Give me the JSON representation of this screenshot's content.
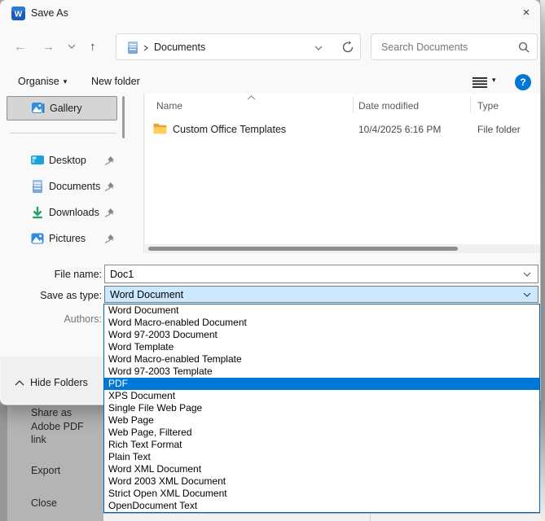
{
  "window": {
    "title": "Save As",
    "close_glyph": "×",
    "word_glyph": "W"
  },
  "nav": {
    "back_glyph": "←",
    "forward_glyph": "→",
    "up_glyph": "↑",
    "breadcrumb": "Documents",
    "search_placeholder": "Search Documents"
  },
  "toolbar": {
    "organise": "Organise",
    "caret_glyph": "▾",
    "new_folder": "New folder",
    "help_glyph": "?"
  },
  "sidebar": {
    "items": [
      {
        "label": "Gallery"
      },
      {
        "label": "Desktop"
      },
      {
        "label": "Documents"
      },
      {
        "label": "Downloads"
      },
      {
        "label": "Pictures"
      }
    ]
  },
  "file_list": {
    "columns": [
      "Name",
      "Date modified",
      "Type"
    ],
    "rows": [
      {
        "name": "Custom Office Templates",
        "date_modified": "10/4/2025 6:16 PM",
        "type": "File folder"
      }
    ]
  },
  "form": {
    "file_name_label": "File name:",
    "file_name_value": "Doc1",
    "save_as_type_label": "Save as type:",
    "save_as_type_value": "Word Document",
    "authors_label": "Authors:"
  },
  "type_dropdown": {
    "selected": "PDF",
    "items": [
      "Word Document",
      "Word Macro-enabled Document",
      "Word 97-2003 Document",
      "Word Template",
      "Word Macro-enabled Template",
      "Word 97-2003 Template",
      "PDF",
      "XPS Document",
      "Single File Web Page",
      "Web Page",
      "Web Page, Filtered",
      "Rich Text Format",
      "Plain Text",
      "Word XML Document",
      "Word 2003 XML Document",
      "Strict Open XML Document",
      "OpenDocument Text"
    ]
  },
  "footer": {
    "hide_folders": "Hide Folders"
  },
  "backstage": {
    "share_link": "Share as Adobe PDF link",
    "export": "Export",
    "close": "Close"
  },
  "colors": {
    "accent": "#0078d7",
    "combo_bg": "#cce8ff",
    "selected_item_bg": "#0078d7",
    "folder": "#ffc83d",
    "help": "#0076d7"
  }
}
